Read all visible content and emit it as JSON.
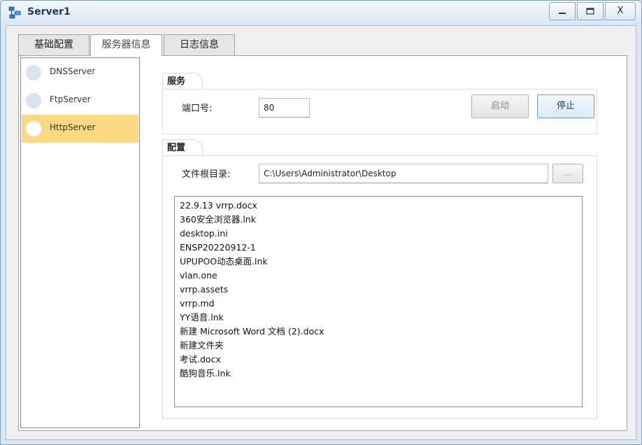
{
  "window": {
    "title": "Server1",
    "icon": "server-network-icon",
    "controls": {
      "minimize": "_",
      "maximize": "□",
      "close": "X"
    }
  },
  "tabs": [
    {
      "label": "基础配置",
      "selected": false
    },
    {
      "label": "服务器信息",
      "selected": true
    },
    {
      "label": "日志信息",
      "selected": false
    }
  ],
  "sidebar": {
    "items": [
      {
        "label": "DNSServer",
        "selected": false
      },
      {
        "label": "FtpServer",
        "selected": false
      },
      {
        "label": "HttpServer",
        "selected": true
      }
    ]
  },
  "service": {
    "group_title": "服务",
    "port_label": "端口号:",
    "port_value": "80",
    "start_label": "启动",
    "stop_label": "停止"
  },
  "config": {
    "group_title": "配置",
    "root_label": "文件根目录:",
    "root_value": "C:\\Users\\Administrator\\Desktop",
    "browse_label": "...",
    "files": [
      "22.9.13  vrrp.docx",
      "360安全浏览器.lnk",
      "desktop.ini",
      "ENSP20220912-1",
      "UPUPOO动态桌面.lnk",
      "vlan.one",
      "vrrp.assets",
      "vrrp.md",
      "YY语音.lnk",
      "新建 Microsoft Word 文档 (2).docx",
      "新建文件夹",
      "考试.docx",
      "酷狗音乐.lnk"
    ]
  },
  "colors": {
    "selected_item": "#fdd983",
    "stop_button_border": "#6b9bd2",
    "title_text": "#1e395b"
  }
}
